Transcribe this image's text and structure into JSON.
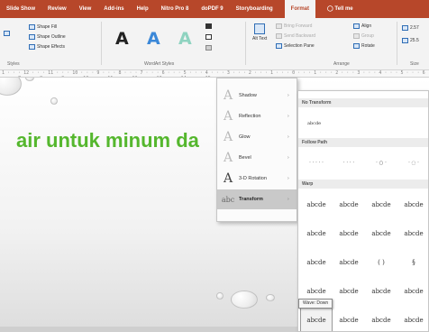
{
  "tabs": [
    {
      "label": "Slide Show",
      "active": false
    },
    {
      "label": "Review",
      "active": false
    },
    {
      "label": "View",
      "active": false
    },
    {
      "label": "Add-ins",
      "active": false
    },
    {
      "label": "Help",
      "active": false
    },
    {
      "label": "Nitro Pro 8",
      "active": false
    },
    {
      "label": "doPDF 9",
      "active": false
    },
    {
      "label": "Storyboarding",
      "active": false
    },
    {
      "label": "Format",
      "active": true
    }
  ],
  "tell_me": "Tell me",
  "ribbon": {
    "shape_fill": "Shape Fill",
    "shape_outline": "Shape Outline",
    "shape_effects": "Shape Effects",
    "styles_group": "Styles",
    "wordart_letters": [
      "A",
      "A",
      "A"
    ],
    "wordart_group": "WordArt Styles",
    "alt_text": "Alt Text",
    "bring_forward": "Bring Forward",
    "send_backward": "Send Backward",
    "selection_pane": "Selection Pane",
    "align": "Align",
    "group": "Group",
    "rotate": "Rotate",
    "arrange_group": "Arrange",
    "size_group": "Size",
    "size_h": "2.57",
    "size_w": "25.5"
  },
  "ruler_text": "1 · · · 12 · · · 11 · · · 10 · · · 9 · · · 8 · · · 7 · · · 6 · · · 5 · · · 4 · · · 3 · · · 2 · · · 1 · · · 0 · · · 1 · · · 2 · · · 3 · · · 4 · · · 5 · · · 6 · · · 7 · · · 8 · · · 9 · · · 10 · · · 11 · · · 12 · · · 13 · · · 14 · · · 15",
  "slide": {
    "text": "air untuk minum da"
  },
  "effects_menu": {
    "items": [
      {
        "label": "Shadow",
        "glyph": "A",
        "arrow": "›"
      },
      {
        "label": "Reflection",
        "glyph": "A",
        "arrow": "›"
      },
      {
        "label": "Glow",
        "glyph": "A",
        "arrow": "›"
      },
      {
        "label": "Bevel",
        "glyph": "A",
        "arrow": "›"
      },
      {
        "label": "3-D Rotation",
        "glyph": "A",
        "arrow": "›"
      },
      {
        "label": "Transform",
        "glyph": "abc",
        "arrow": "›"
      }
    ]
  },
  "transform_panel": {
    "no_transform_header": "No Transform",
    "no_transform_sample": "abcde",
    "follow_path_header": "Follow Path",
    "follow_path_items": [
      "· · · · ·",
      "· · · ·",
      "· ○ ·",
      "· ◌ ·"
    ],
    "warp_header": "Warp",
    "warp_rows": [
      [
        "abcde",
        "abcde",
        "abcde",
        "abcde"
      ],
      [
        "abcde",
        "abcde",
        "abcde",
        "abcde"
      ],
      [
        "abcde",
        "abcde",
        "( )",
        "§"
      ],
      [
        "abcde",
        "abcde",
        "abcde",
        "abcde"
      ],
      [
        "abcde",
        "abcde",
        "abcde",
        "abcde"
      ]
    ]
  },
  "tooltip": "Wave: Down"
}
